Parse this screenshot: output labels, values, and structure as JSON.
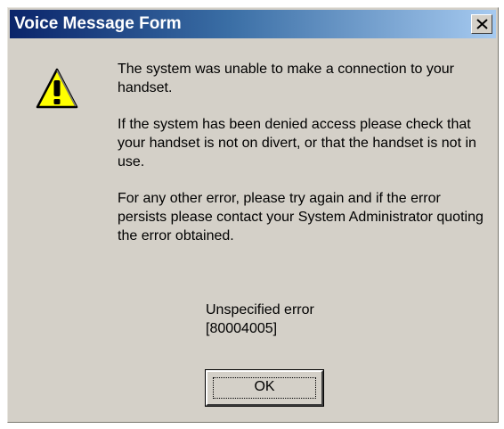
{
  "window": {
    "title": "Voice Message Form"
  },
  "message": {
    "icon": "warning-icon",
    "paragraphs": [
      "The system was unable to make a connection to your handset.",
      "If the system has been denied access please check that your handset is not on divert, or that the handset is not in use.",
      "For any other error, please try again and if the error persists please contact your System Administrator quoting the error obtained."
    ]
  },
  "error": {
    "description": "Unspecified error",
    "code": "[80004005]"
  },
  "buttons": {
    "ok_label": "OK"
  },
  "colors": {
    "titlebar_start": "#0a246a",
    "titlebar_end": "#a6caf0",
    "dialog_face": "#d4d0c8",
    "warning_fill": "#ffff00"
  }
}
